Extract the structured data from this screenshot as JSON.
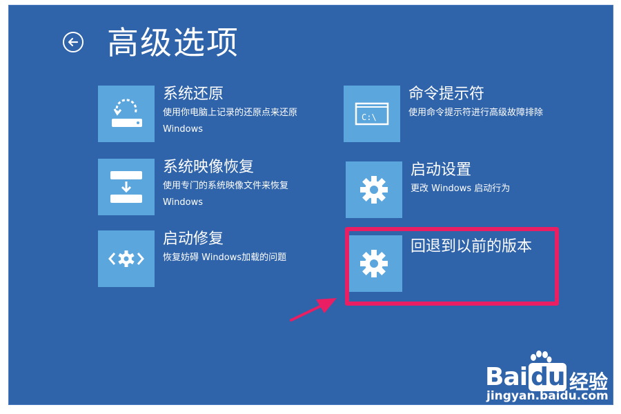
{
  "page": {
    "title": "高级选项",
    "back_icon": "back-arrow-icon"
  },
  "options": [
    {
      "label": "系统还原",
      "desc": "使用你电脑上记录的还原点来还原 Windows",
      "icon": "system-restore-icon"
    },
    {
      "label": "命令提示符",
      "desc": "使用命令提示符进行高级故障排除",
      "icon": "command-prompt-icon"
    },
    {
      "label": "系统映像恢复",
      "desc": "使用专门的系统映像文件来恢复 Windows",
      "icon": "system-image-recovery-icon"
    },
    {
      "label": "启动设置",
      "desc": "更改 Windows 启动行为",
      "icon": "gear-icon"
    },
    {
      "label": "启动修复",
      "desc": "恢复妨碍 Windows加载的问题",
      "icon": "startup-repair-icon"
    },
    {
      "label": "回退到以前的版本",
      "desc": "",
      "icon": "gear-icon"
    }
  ],
  "command_prompt_glyph": "C:\\",
  "watermark": {
    "logo_prefix": "Bai",
    "logo_suffix": "du",
    "brand": "经验",
    "url": "jingyan.baidu.com"
  },
  "colors": {
    "background": "#2f63aa",
    "tile": "#5ca6de",
    "highlight": "#e91e63"
  }
}
